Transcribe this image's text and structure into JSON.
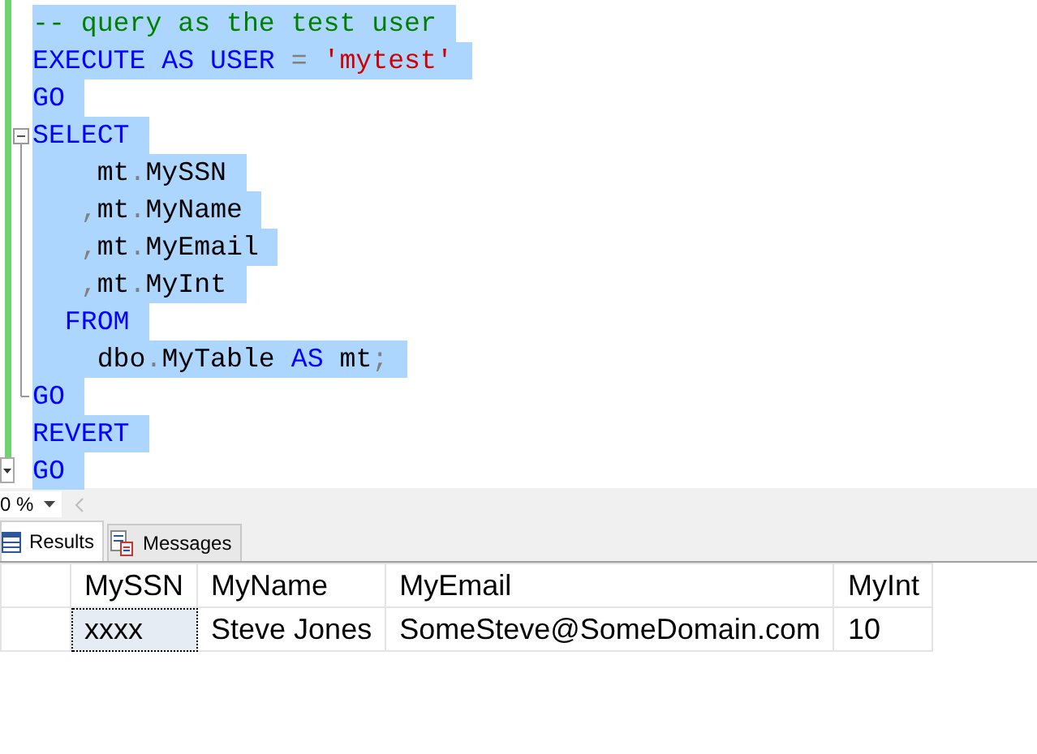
{
  "editor": {
    "lines": [
      {
        "selected": true,
        "tokens": [
          {
            "kind": "comment",
            "text": "-- query as the test user"
          }
        ]
      },
      {
        "selected": true,
        "tokens": [
          {
            "kind": "keyword",
            "text": "EXECUTE AS USER"
          },
          {
            "kind": "operator",
            "text": " = "
          },
          {
            "kind": "string",
            "text": "'mytest'"
          }
        ]
      },
      {
        "selected": true,
        "tokens": [
          {
            "kind": "keyword",
            "text": "GO"
          }
        ]
      },
      {
        "selected": true,
        "tokens": [
          {
            "kind": "keyword",
            "text": "SELECT"
          }
        ]
      },
      {
        "selected": true,
        "tokens": [
          {
            "kind": "plain",
            "text": "    mt"
          },
          {
            "kind": "operator",
            "text": "."
          },
          {
            "kind": "plain",
            "text": "MySSN"
          }
        ]
      },
      {
        "selected": true,
        "tokens": [
          {
            "kind": "operator",
            "text": "   ,"
          },
          {
            "kind": "plain",
            "text": "mt"
          },
          {
            "kind": "operator",
            "text": "."
          },
          {
            "kind": "plain",
            "text": "MyName"
          }
        ]
      },
      {
        "selected": true,
        "tokens": [
          {
            "kind": "operator",
            "text": "   ,"
          },
          {
            "kind": "plain",
            "text": "mt"
          },
          {
            "kind": "operator",
            "text": "."
          },
          {
            "kind": "plain",
            "text": "MyEmail"
          }
        ]
      },
      {
        "selected": true,
        "tokens": [
          {
            "kind": "operator",
            "text": "   ,"
          },
          {
            "kind": "plain",
            "text": "mt"
          },
          {
            "kind": "operator",
            "text": "."
          },
          {
            "kind": "plain",
            "text": "MyInt"
          }
        ]
      },
      {
        "selected": true,
        "tokens": [
          {
            "kind": "keyword",
            "text": "  FROM"
          }
        ]
      },
      {
        "selected": true,
        "tokens": [
          {
            "kind": "plain",
            "text": "    dbo"
          },
          {
            "kind": "operator",
            "text": "."
          },
          {
            "kind": "plain",
            "text": "MyTable "
          },
          {
            "kind": "keyword",
            "text": "AS"
          },
          {
            "kind": "plain",
            "text": " mt"
          },
          {
            "kind": "operator",
            "text": ";"
          }
        ]
      },
      {
        "selected": true,
        "tokens": [
          {
            "kind": "keyword",
            "text": "GO"
          }
        ]
      },
      {
        "selected": true,
        "tokens": [
          {
            "kind": "keyword",
            "text": "REVERT"
          }
        ]
      },
      {
        "selected": true,
        "tokens": [
          {
            "kind": "keyword",
            "text": "GO"
          }
        ]
      }
    ]
  },
  "zoom": {
    "value": "0 %"
  },
  "tabs": [
    {
      "label": "Results",
      "selected": true
    },
    {
      "label": "Messages",
      "selected": false
    }
  ],
  "grid": {
    "columns": [
      "MySSN",
      "MyName",
      "MyEmail",
      "MyInt"
    ],
    "rows": [
      {
        "cells": [
          {
            "text": "xxxx",
            "selected": true
          },
          {
            "text": "Steve Jones",
            "selected": false
          },
          {
            "text": "SomeSteve@SomeDomain.com",
            "selected": false
          },
          {
            "text": "10",
            "selected": false
          }
        ]
      }
    ]
  }
}
